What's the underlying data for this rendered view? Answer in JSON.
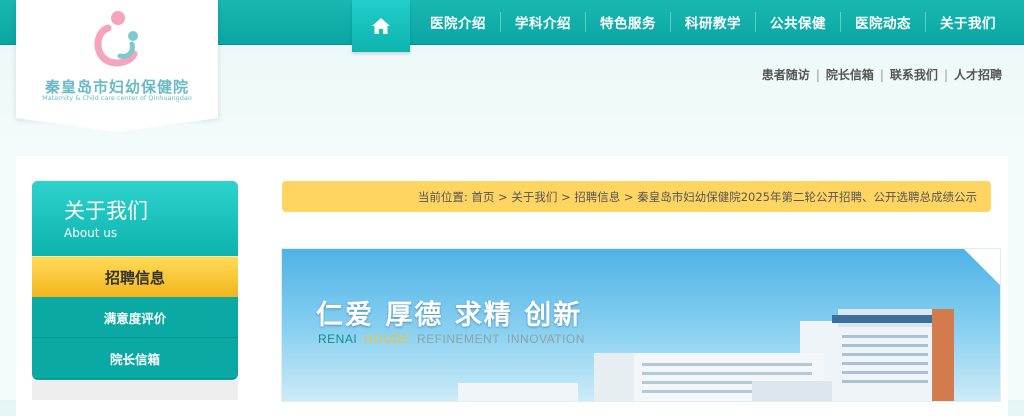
{
  "colors": {
    "brand_teal": "#0aa6a3",
    "highlight_yellow": "#ffd562",
    "logo_pink": "#f4a4bd",
    "logo_teal": "#6ab9c4"
  },
  "logo": {
    "name_cn": "秦皇岛市妇幼保健院",
    "name_en": "Maternity & Child care center of Qinhuangdao"
  },
  "nav": {
    "home_icon": "home-icon",
    "items": [
      "医院介绍",
      "学科介绍",
      "特色服务",
      "科研教学",
      "公共保健",
      "医院动态",
      "关于我们"
    ]
  },
  "toplinks": [
    "患者随访",
    "院长信箱",
    "联系我们",
    "人才招聘"
  ],
  "sidebar": {
    "title": "关于我们",
    "subtitle": "About us",
    "active": "招聘信息",
    "items": [
      "满意度评价",
      "院长信箱"
    ]
  },
  "breadcrumb": "当前位置: 首页 > 关于我们 > 招聘信息 > 秦皇岛市妇幼保健院2025年第二轮公开招聘、公开选聘总成绩公示",
  "banner": {
    "slogan": "仁爱 厚德 求精 创新",
    "words": [
      {
        "text": "RENAI",
        "color": "#0e8f8a"
      },
      {
        "text": "HOUDE",
        "color": "#f3c13a"
      },
      {
        "text": "REFINEMENT",
        "color": "#8fa0a8"
      },
      {
        "text": "INNOVATION",
        "color": "#8fa0a8"
      }
    ]
  }
}
